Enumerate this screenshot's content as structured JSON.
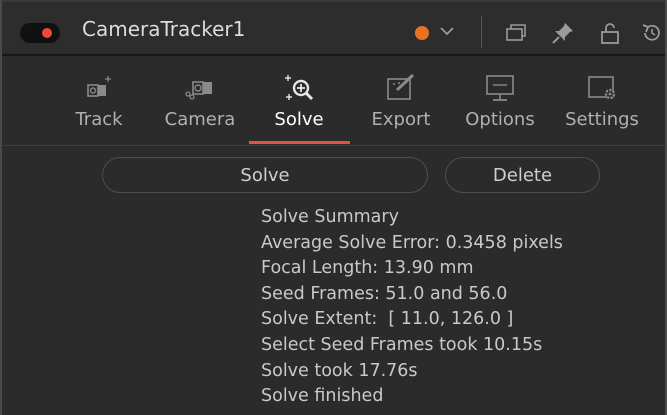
{
  "header": {
    "title": "CameraTracker1",
    "enable_toggle": "on",
    "color_tag": "#e8731f",
    "icons": [
      "chevron-down-icon",
      "versions-icon",
      "pin-icon",
      "lock-icon",
      "reset-icon"
    ]
  },
  "tabs": [
    {
      "label": "Track",
      "icon": "track-camera-icon",
      "active": false
    },
    {
      "label": "Camera",
      "icon": "camera-icon",
      "active": false
    },
    {
      "label": "Solve",
      "icon": "solve-icon",
      "active": true
    },
    {
      "label": "Export",
      "icon": "export-icon",
      "active": false
    },
    {
      "label": "Options",
      "icon": "options-icon",
      "active": false
    },
    {
      "label": "Settings",
      "icon": "settings-icon",
      "active": false
    }
  ],
  "buttons": {
    "solve": "Solve",
    "delete": "Delete"
  },
  "summary": {
    "heading": "Solve Summary",
    "lines": [
      "Average Solve Error: 0.3458 pixels",
      "Focal Length: 13.90 mm",
      "Seed Frames: 51.0 and 56.0",
      "Solve Extent:  [ 11.0, 126.0 ]",
      "Select Seed Frames took 10.15s",
      "Solve took 17.76s",
      "Solve finished"
    ]
  },
  "colors": {
    "accent": "#e4533f",
    "background": "#2b2b2b",
    "toggle_on": "#f04a3a"
  }
}
